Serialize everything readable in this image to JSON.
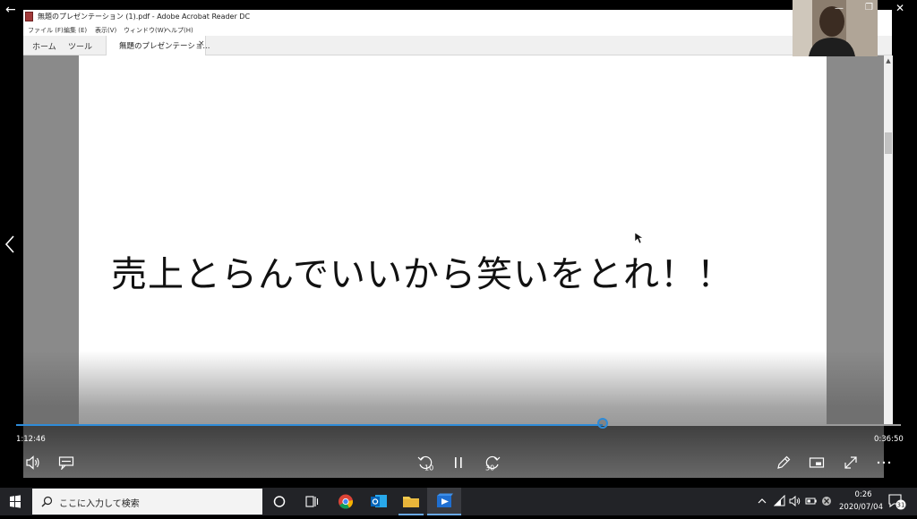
{
  "acrobat": {
    "window_title": "無題のプレゼンテーション (1).pdf - Adobe Acrobat Reader DC",
    "menu": [
      "ファイル (F)",
      "編集 (E)",
      "表示(V)",
      "ウィンドウ(W)",
      "ヘルプ(H)"
    ],
    "nav_tabs": [
      "ホーム",
      "ツール"
    ],
    "document_tab": "無題のプレゼンテーショ...",
    "document_tab_close": "×",
    "slide_text": "売上とらんでいいから笑いをとれ！！",
    "scroll_up_glyph": "▲"
  },
  "player": {
    "elapsed": "1:12:46",
    "remaining": "0:36:50",
    "progress_fraction": 0.663,
    "skip_back_label": "10",
    "skip_forward_label": "30",
    "back_glyph": "←"
  },
  "window_controls": {
    "minimize": "—",
    "restore": "❐",
    "close": "✕"
  },
  "taskbar": {
    "search_placeholder": "ここに入力して検索",
    "clock_time": "0:26",
    "clock_date": "2020/07/04",
    "notification_count": "31"
  },
  "colors": {
    "accent": "#2e8bd8",
    "taskbar": "#222327"
  }
}
